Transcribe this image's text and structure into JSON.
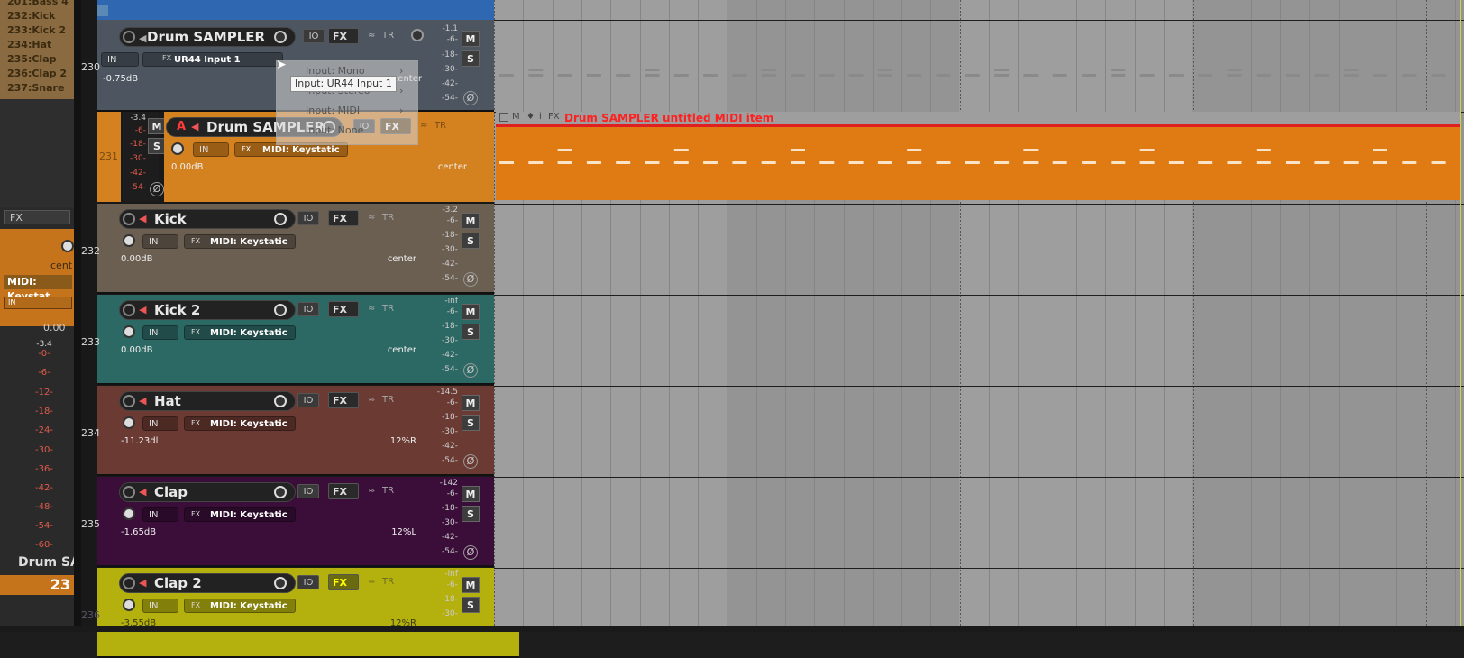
{
  "left_panel": {
    "track_list": [
      "201:Bass 4",
      "232:Kick",
      "233:Kick 2",
      "234:Hat",
      "235:Clap",
      "236:Clap 2",
      "237:Snare"
    ],
    "fx_label": "FX",
    "pan_label": "cent",
    "input_label": "MIDI: Keystat",
    "in_label": "IN",
    "volume": "0.00",
    "meter_scale": [
      "-3.4",
      "-0-",
      "-6-",
      "-12-",
      "-18-",
      "-24-",
      "-30-",
      "-36-",
      "-42-",
      "-48-",
      "-54-",
      "-60-"
    ],
    "track_name": "Drum SA",
    "track_number": "23"
  },
  "tracks": [
    {
      "number": "230",
      "name": "Drum SAMPLER",
      "input": "UR44 Input 1",
      "volume": "-0.75dB",
      "pan": "center",
      "meter": [
        "-1.1",
        "-6-",
        "-18-",
        "-30-",
        "-42-",
        "-54-"
      ],
      "color": "#4c5560"
    },
    {
      "number": "231",
      "name": "Drum SAMPLER",
      "input": "MIDI: Keystatic",
      "volume": "0.00dB",
      "pan": "center",
      "meter": [
        "-3.4",
        "-6-",
        "-18-",
        "-30-",
        "-42-",
        "-54-"
      ],
      "color": "#d4821f",
      "armed": "A"
    },
    {
      "number": "232",
      "name": "Kick",
      "input": "MIDI: Keystatic",
      "volume": "0.00dB",
      "pan": "center",
      "meter": [
        "-3.2",
        "-6-",
        "-18-",
        "-30-",
        "-42-",
        "-54-"
      ],
      "color": "#6b5f52"
    },
    {
      "number": "233",
      "name": "Kick 2",
      "input": "MIDI: Keystatic",
      "volume": "0.00dB",
      "pan": "center",
      "meter": [
        "-inf",
        "-6-",
        "-18-",
        "-30-",
        "-42-",
        "-54-"
      ],
      "color": "#2d6964"
    },
    {
      "number": "234",
      "name": "Hat",
      "input": "MIDI: Keystatic",
      "volume": "-11.23dl",
      "pan": "12%R",
      "meter": [
        "-14.5",
        "-6-",
        "-18-",
        "-30-",
        "-42-",
        "-54-"
      ],
      "color": "#6b3a33"
    },
    {
      "number": "235",
      "name": "Clap",
      "input": "MIDI: Keystatic",
      "volume": "-1.65dB",
      "pan": "12%L",
      "meter": [
        "-142",
        "-6-",
        "-18-",
        "-30-",
        "-42-",
        "-54-"
      ],
      "color": "#3b0e3a"
    },
    {
      "number": "236",
      "name": "Clap 2",
      "input": "MIDI: Keystatic",
      "volume": "-3.55dB",
      "pan": "12%R",
      "meter": [
        "-inf",
        "-6-",
        "-18-",
        "-30-"
      ],
      "color": "#b4b00e"
    }
  ],
  "buttons": {
    "in": "IN",
    "fx": "FX",
    "io": "IO",
    "tr": "TR",
    "mute": "M",
    "solo": "S",
    "phase": "Ø",
    "fx_small": "FX"
  },
  "input_menu": {
    "items": [
      "Input: Mono",
      "Input: Stereo",
      "Input: MIDI",
      "Input: None"
    ],
    "tooltip": "Input: UR44 Input 1"
  },
  "midi_item": {
    "title": "Drum SAMPLER untitled MIDI item",
    "header_icons": [
      "M",
      "i",
      "FX"
    ]
  },
  "colors": {
    "accent_orange": "#e07b14",
    "item_title_red": "#ff2020",
    "arrange_bg": "#9e9e9e"
  }
}
